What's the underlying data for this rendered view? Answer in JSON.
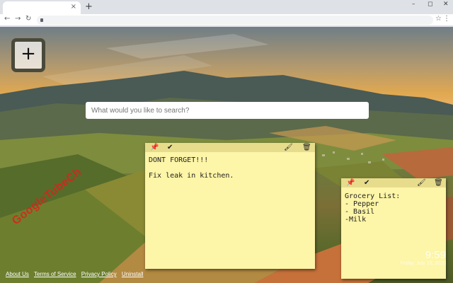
{
  "browser": {
    "new_tab": "+",
    "tab_close": "×",
    "win_min": "–",
    "win_max": "◻",
    "win_close": "✕",
    "back": "←",
    "forward": "→",
    "reload": "↻",
    "star": "☆",
    "menu": "⋮"
  },
  "add_button": {
    "label": "+"
  },
  "search": {
    "placeholder": "What would you like to search?"
  },
  "notes": [
    {
      "text": "DONT FORGET!!!\n\nFix leak in kitchen."
    },
    {
      "text": "Grocery List:\n- Pepper\n- Basil\n-Milk"
    }
  ],
  "note_icons": {
    "pin": "📌",
    "check": "✔",
    "brush": "🖌",
    "trash": "🗑"
  },
  "clock": {
    "time": "9:59",
    "date": "Friday, July 10, 2020"
  },
  "footer": {
    "about": "About Us",
    "terms": "Terms of Service",
    "privacy": "Privacy Policy",
    "uninstall": "Uninstall"
  },
  "watermark": "GoogleTubeCh"
}
